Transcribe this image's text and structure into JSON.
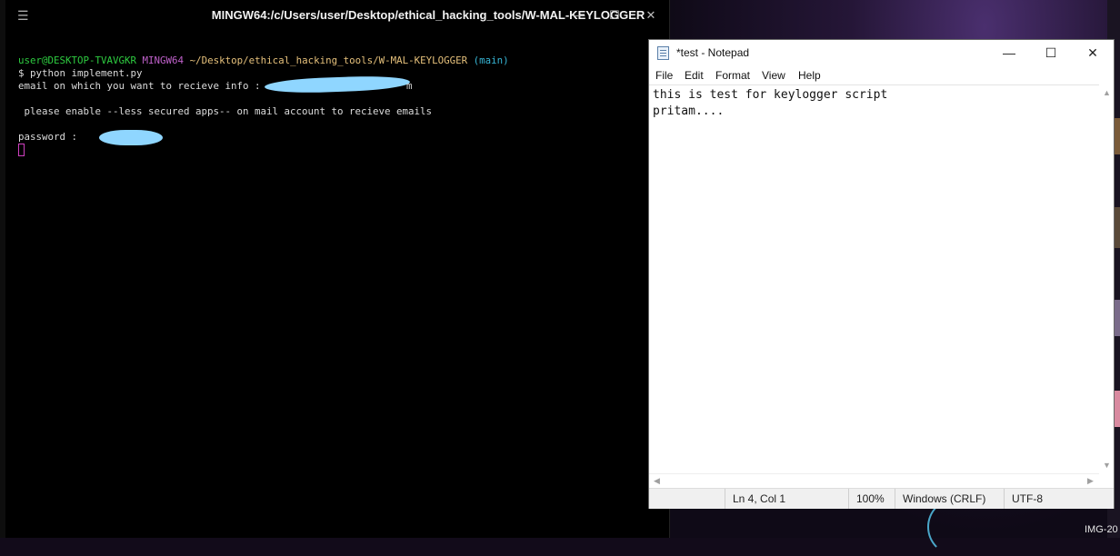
{
  "terminal": {
    "title": "MINGW64:/c/Users/user/Desktop/ethical_hacking_tools/W-MAL-KEYLOGGER",
    "menu_icon": "hamburger-icon",
    "prompt_user": "user@DESKTOP-TVAVGKR",
    "prompt_shell": "MINGW64",
    "prompt_path": "~/Desktop/ethical_hacking_tools/W-MAL-KEYLOGGER",
    "prompt_branch": "(main)",
    "command": "$ python implement.py",
    "email_prompt": "email on which you want to recieve info :",
    "email_tail": "m",
    "notice": " please enable --less secured apps-- on mail account to recieve emails",
    "password_prompt": "password :",
    "colors": {
      "user": "#2ecc40",
      "shell": "#c061cb",
      "path": "#e5c07b",
      "branch": "#37b6d6",
      "redaction": "#8fd6ff"
    }
  },
  "notepad": {
    "title": "*test - Notepad",
    "menu": [
      "File",
      "Edit",
      "Format",
      "View",
      "Help"
    ],
    "lines": [
      "this is test for keylogger script",
      "pritam...."
    ],
    "status": {
      "position": "Ln 4, Col 1",
      "zoom": "100%",
      "line_ending": "Windows (CRLF)",
      "encoding": "UTF-8"
    }
  },
  "desktop": {
    "label": "IMG-20"
  }
}
